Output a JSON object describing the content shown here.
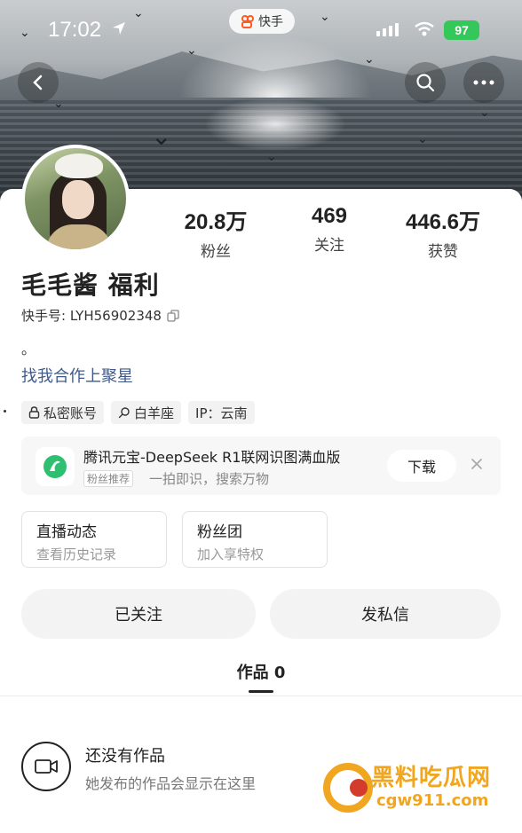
{
  "status_bar": {
    "time": "17:02",
    "app_name": "快手",
    "battery": "97"
  },
  "profile": {
    "name": "毛毛酱 福利",
    "kuaishou_id": "快手号: LYH56902348",
    "bio": "。",
    "link": "找我合作上聚星",
    "stats": [
      {
        "value": "20.8万",
        "label": "粉丝"
      },
      {
        "value": "469",
        "label": "关注"
      },
      {
        "value": "446.6万",
        "label": "获赞"
      }
    ],
    "tags": [
      {
        "icon": "lock-icon",
        "label": "私密账号"
      },
      {
        "icon": "aries-icon",
        "label": "白羊座"
      },
      {
        "icon": "",
        "label": "IP：云南"
      }
    ]
  },
  "ad": {
    "title": "腾讯元宝-DeepSeek R1联网识图满血版",
    "badge": "粉丝推荐",
    "description": "一拍即识，搜索万物",
    "download_label": "下载"
  },
  "feature_boxes": [
    {
      "title": "直播动态",
      "subtitle": "查看历史记录"
    },
    {
      "title": "粉丝团",
      "subtitle": "加入享特权"
    }
  ],
  "actions": {
    "followed_label": "已关注",
    "message_label": "发私信"
  },
  "tabs": {
    "works_label": "作品 0"
  },
  "empty_state": {
    "title": "还没有作品",
    "subtitle": "她发布的作品会显示在这里"
  },
  "watermark": {
    "line1": "黑料吃瓜网",
    "line2": "cgw911.com"
  },
  "colors": {
    "battery_green": "#34c759",
    "link_blue": "#3f5a8a",
    "watermark_orange": "#f0a620"
  }
}
